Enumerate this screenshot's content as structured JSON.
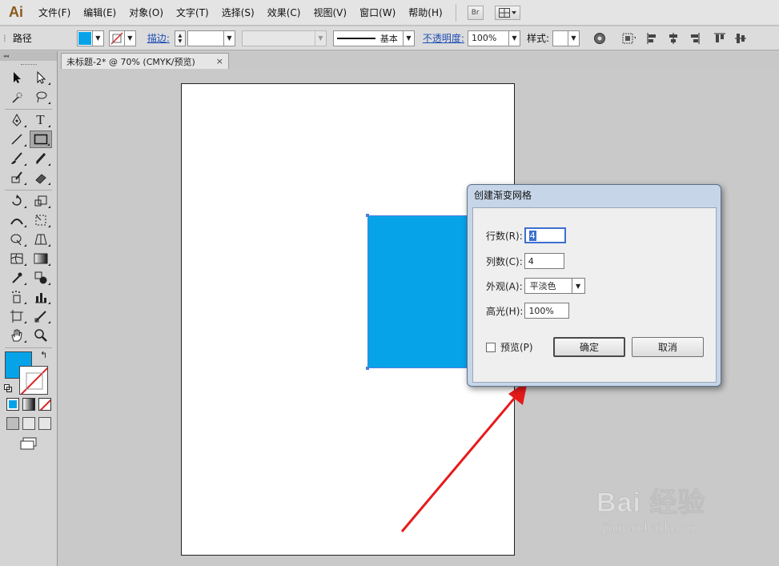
{
  "app": {
    "logo": "Ai"
  },
  "menu": {
    "items": [
      "文件(F)",
      "编辑(E)",
      "对象(O)",
      "文字(T)",
      "选择(S)",
      "效果(C)",
      "视图(V)",
      "窗口(W)",
      "帮助(H)"
    ],
    "bridge_label": "Br"
  },
  "control_bar": {
    "object_type": "路径",
    "fill_color": "#07a3e9",
    "stroke_label": "描边:",
    "stroke_style": "基本",
    "opacity_label": "不透明度:",
    "opacity_value": "100%",
    "style_label": "样式:"
  },
  "document_tab": {
    "title": "未标题-2* @ 70% (CMYK/预览)",
    "close": "×"
  },
  "toolbox": {
    "collapse": "◂◂",
    "fill_color": "#07a3e9"
  },
  "canvas": {
    "rect_color": "#07a3e9"
  },
  "dialog": {
    "title": "创建渐变网格",
    "rows_label": "行数(R):",
    "rows_value": "4",
    "cols_label": "列数(C):",
    "cols_value": "4",
    "appearance_label": "外观(A):",
    "appearance_value": "平淡色",
    "highlight_label": "高光(H):",
    "highlight_value": "100%",
    "preview_label": "预览(P)",
    "ok_label": "确定",
    "cancel_label": "取消"
  },
  "watermark": {
    "brand": "Bai 经验",
    "url": "jingyan.baidu.com"
  }
}
